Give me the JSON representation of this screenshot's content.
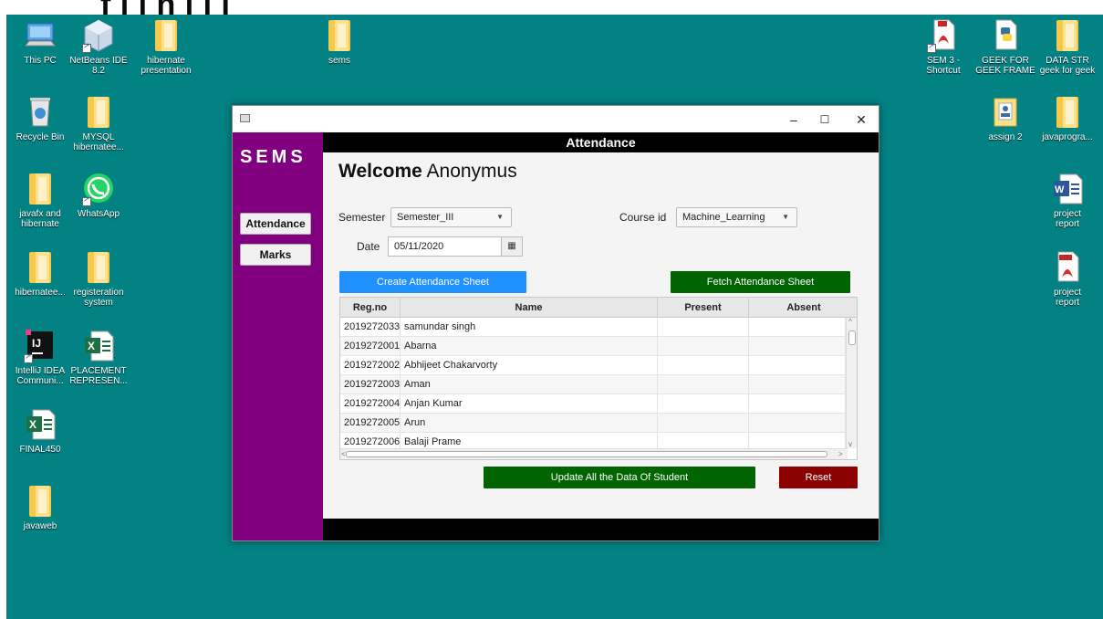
{
  "heading_text": "f j   l      h             i                     l     i",
  "desktop_icons": {
    "this_pc": "This PC",
    "netbeans": "NetBeans IDE\n8.2",
    "hibernate_presentation": "hibernate\npresentation",
    "sems": "sems",
    "recycle_bin": "Recycle Bin",
    "mysql": "MYSQL\nhibernatee...",
    "javafx": "javafx and\nhibernate",
    "whatsapp": "WhatsApp",
    "hibernatee": "hibernatee...",
    "registeration": "registeration\nsystem",
    "intellij": "IntelliJ IDEA\nCommuni...",
    "placement": "PLACEMENT\nREPRESEN...",
    "final450": "FINAL450",
    "javaweb": "javaweb",
    "sem3": "SEM 3 -\nShortcut",
    "geek": "GEEK FOR\nGEEK FRAME",
    "datastr": "DATA STR\ngeek for geek",
    "assign2": "assign 2",
    "javaprogra": "javaprogra...",
    "project_report_word": "project\nreport",
    "project_report_pdf": "project\nreport"
  },
  "window": {
    "minimize": "–",
    "maximize": "☐",
    "close": "✕"
  },
  "sidebar": {
    "brand": "SEMS",
    "attendance_btn": "Attendance",
    "marks_btn": "Marks"
  },
  "main": {
    "title": "Attendance",
    "welcome_bold": "Welcome",
    "welcome_name": "Anonymus",
    "semester_label": "Semester",
    "semester_value": "Semester_III",
    "course_label": "Course id",
    "course_value": "Machine_Learning",
    "date_label": "Date",
    "date_value": "05/11/2020",
    "create_btn": "Create Attendance Sheet",
    "fetch_btn": "Fetch Attendance Sheet",
    "update_btn": "Update All the Data Of Student",
    "reset_btn": "Reset"
  },
  "table": {
    "headers": [
      "Reg.no",
      "Name",
      "Present",
      "Absent"
    ],
    "rows": [
      [
        "2019272033",
        "samundar singh",
        "",
        ""
      ],
      [
        "2019272001",
        "Abarna",
        "",
        ""
      ],
      [
        "2019272002",
        "Abhijeet Chakarvorty",
        "",
        ""
      ],
      [
        "2019272003",
        "Aman",
        "",
        ""
      ],
      [
        "2019272004",
        "Anjan Kumar",
        "",
        ""
      ],
      [
        "2019272005",
        "Arun",
        "",
        ""
      ],
      [
        "2019272006",
        "Balaji Prame",
        "",
        ""
      ]
    ]
  },
  "colors": {
    "desktop": "#028283",
    "sidebar": "#800080",
    "create_btn": "#1e90ff",
    "fetch_btn": "#006400",
    "update_btn": "#006400",
    "reset_btn": "#8b0000"
  }
}
